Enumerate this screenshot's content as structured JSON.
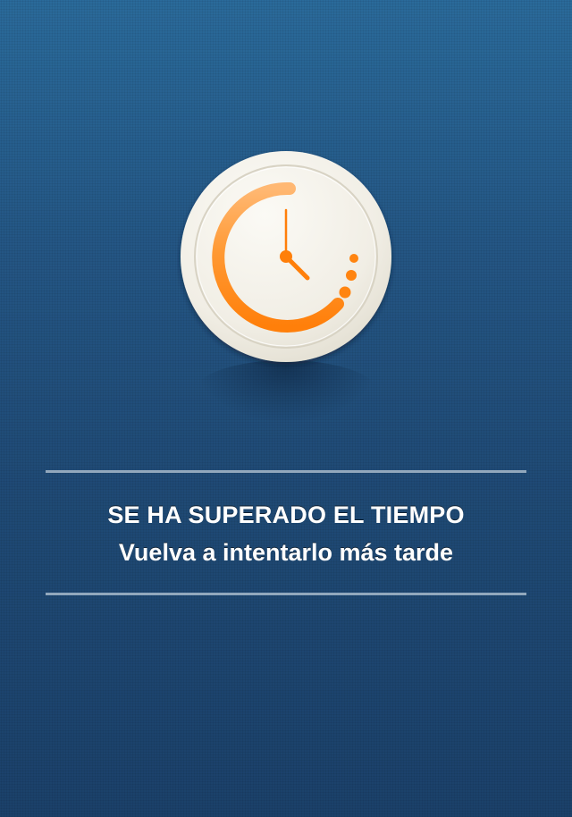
{
  "message": {
    "title": "SE HA SUPERADO EL TIEMPO",
    "subtitle": "Vuelva a intentarlo más tarde"
  },
  "icon": {
    "name": "clock-timeout-icon",
    "accent_color": "#ff8410",
    "face_color": "#f2efe6"
  },
  "colors": {
    "background_top": "#2a6a9a",
    "background_bottom": "#1b416a",
    "divider": "#9fb2c5",
    "text": "#ffffff"
  }
}
